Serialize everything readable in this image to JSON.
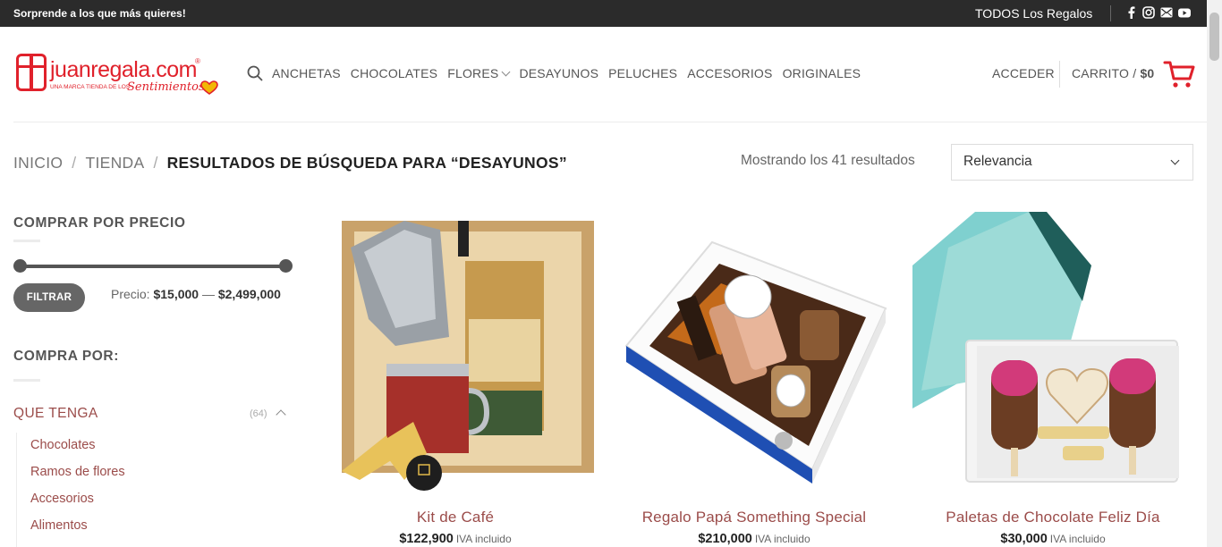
{
  "topbar": {
    "promo": "Sorprende a los que más quieres!",
    "all_gifts": "TODOS Los Regalos",
    "social": [
      "facebook-icon",
      "instagram-icon",
      "email-icon",
      "youtube-icon"
    ]
  },
  "header": {
    "brand": "juanregala.com",
    "brand_mark": "®",
    "tagline": "UNA MARCA TIENDA DE LOS",
    "tagline_script": "Sentimientos",
    "nav": [
      "ANCHETAS",
      "CHOCOLATES",
      "FLORES",
      "DESAYUNOS",
      "PELUCHES",
      "ACCESORIOS",
      "ORIGINALES"
    ],
    "login": "ACCEDER",
    "cart_label": "CARRITO",
    "cart_sep": "/",
    "cart_total": "$0"
  },
  "breadcrumb": {
    "home": "INICIO",
    "shop": "TIENDA",
    "divider": "/",
    "current": "RESULTADOS DE BÚSQUEDA PARA “DESAYUNOS”"
  },
  "results_text": "Mostrando los 41 resultados",
  "sort": {
    "selected": "Relevancia"
  },
  "sidebar": {
    "price_heading": "COMPRAR POR PRECIO",
    "filter_button": "FILTRAR",
    "price_prefix": "Precio:",
    "price_min": "$15,000",
    "price_dash": "—",
    "price_max": "$2,499,000",
    "browse_heading": "COMPRA POR:",
    "category": {
      "label": "QUE TENGA",
      "count": "(64)"
    },
    "subcategories": [
      "Chocolates",
      "Ramos de flores",
      "Accesorios",
      "Alimentos"
    ]
  },
  "products": [
    {
      "name": "Kit de Café",
      "price": "$122,900",
      "tax": "IVA incluido"
    },
    {
      "name": "Regalo Papá Something Special",
      "price": "$210,000",
      "tax": "IVA incluido"
    },
    {
      "name": "Paletas de Chocolate Feliz Día",
      "price": "$30,000",
      "tax": "IVA incluido"
    }
  ],
  "colors": {
    "brand_red": "#e0212b",
    "link_brown": "#9b4c4a",
    "topbar": "#2b2b2b"
  }
}
